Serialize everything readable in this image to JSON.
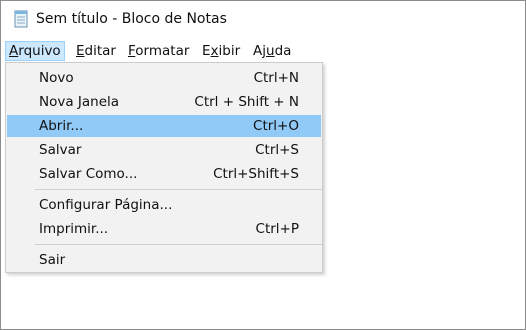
{
  "window": {
    "title": "Sem título - Bloco de Notas",
    "icon": "notepad-icon"
  },
  "menubar": {
    "items": [
      {
        "pre": "",
        "mnemonic": "A",
        "post": "rquivo"
      },
      {
        "pre": "",
        "mnemonic": "E",
        "post": "ditar"
      },
      {
        "pre": "",
        "mnemonic": "F",
        "post": "ormatar"
      },
      {
        "pre": "E",
        "mnemonic": "x",
        "post": "ibir"
      },
      {
        "pre": "Aj",
        "mnemonic": "u",
        "post": "da"
      }
    ],
    "active_index": 0
  },
  "file_menu": {
    "items": [
      {
        "label": "Novo",
        "shortcut": "Ctrl+N"
      },
      {
        "label": "Nova Janela",
        "shortcut": "Ctrl + Shift + N"
      },
      {
        "label": "Abrir...",
        "shortcut": "Ctrl+O"
      },
      {
        "label": "Salvar",
        "shortcut": "Ctrl+S"
      },
      {
        "label": "Salvar Como...",
        "shortcut": "Ctrl+Shift+S"
      },
      {
        "label": "Configurar Página...",
        "shortcut": ""
      },
      {
        "label": "Imprimir...",
        "shortcut": "Ctrl+P"
      },
      {
        "label": "Sair",
        "shortcut": ""
      }
    ],
    "highlighted_index": 2
  },
  "colors": {
    "menu_highlight": "#91c9f7",
    "menubar_active": "#cce8ff",
    "menu_background": "#f2f2f2"
  }
}
